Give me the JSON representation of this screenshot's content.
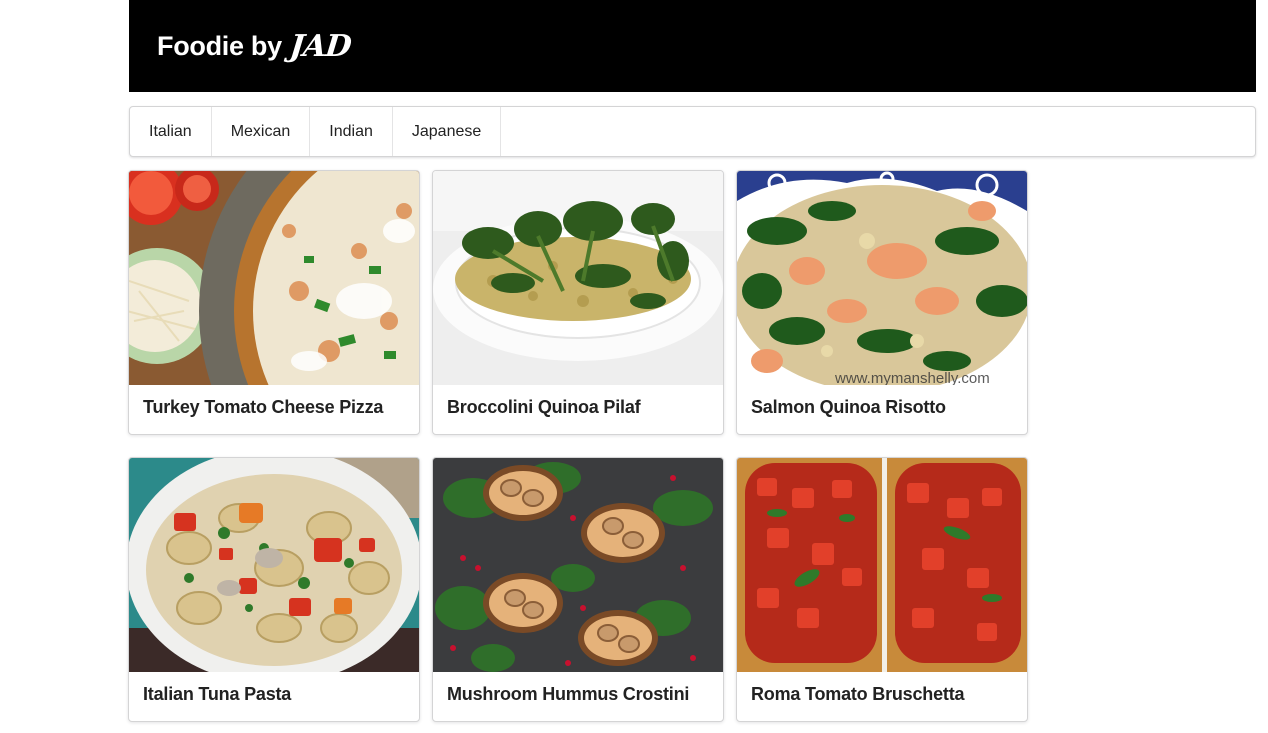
{
  "header": {
    "brand_text": "Foodie by",
    "brand_logo": "JAD"
  },
  "nav": {
    "items": [
      "Italian",
      "Mexican",
      "Indian",
      "Japanese"
    ]
  },
  "recipes": [
    {
      "title": "Turkey Tomato Cheese Pizza",
      "image": "pizza-photo"
    },
    {
      "title": "Broccolini Quinoa Pilaf",
      "image": "quinoa-pilaf-photo"
    },
    {
      "title": "Salmon Quinoa Risotto",
      "image": "salmon-risotto-photo"
    },
    {
      "title": "Italian Tuna Pasta",
      "image": "tuna-pasta-photo"
    },
    {
      "title": "Mushroom Hummus Crostini",
      "image": "mushroom-crostini-photo"
    },
    {
      "title": "Roma Tomato Bruschetta",
      "image": "bruschetta-photo"
    }
  ],
  "photo_watermark": "www.mymanshelly.com"
}
